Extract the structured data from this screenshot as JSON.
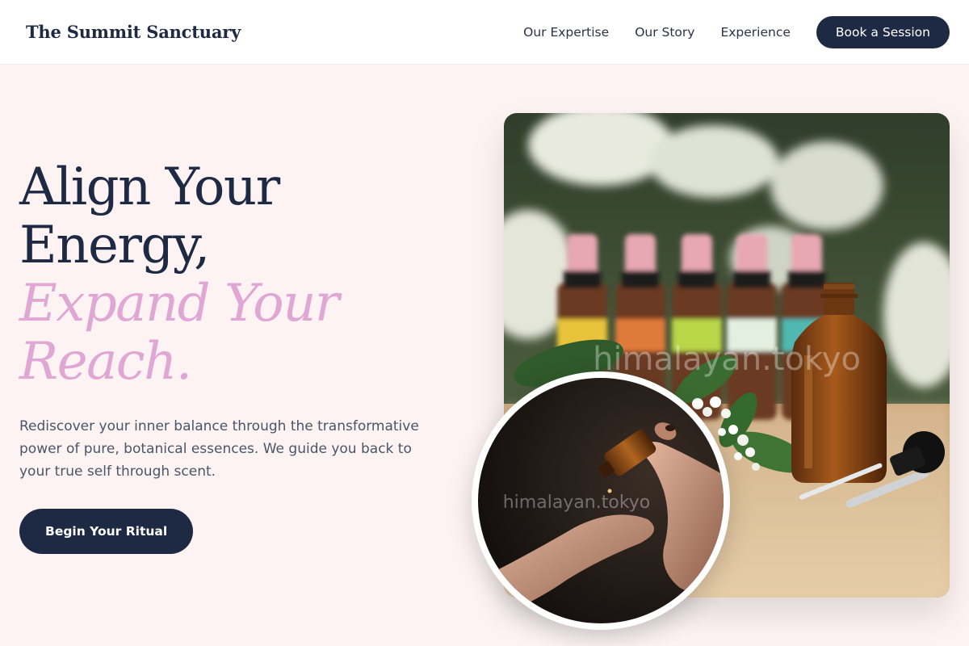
{
  "header": {
    "brand": "The Summit Sanctuary",
    "nav": [
      "Our Expertise",
      "Our Story",
      "Experience"
    ],
    "cta": "Book a Session"
  },
  "hero": {
    "headline_line1": "Align Your",
    "headline_line2": "Energy,",
    "headline_accent_line1": "Expand Your",
    "headline_accent_line2": "Reach.",
    "description": "Rediscover your inner balance through the transformative power of pure, botanical essences. We guide you back to your true self through scent.",
    "cta": "Begin Your Ritual"
  },
  "images": {
    "main_watermark": "himalayan.tokyo",
    "inset_watermark": "himalayan.tokyo"
  },
  "colors": {
    "navy": "#1e2a44",
    "accent_pink": "#e0a6d4",
    "background": "#fdf3f3"
  }
}
